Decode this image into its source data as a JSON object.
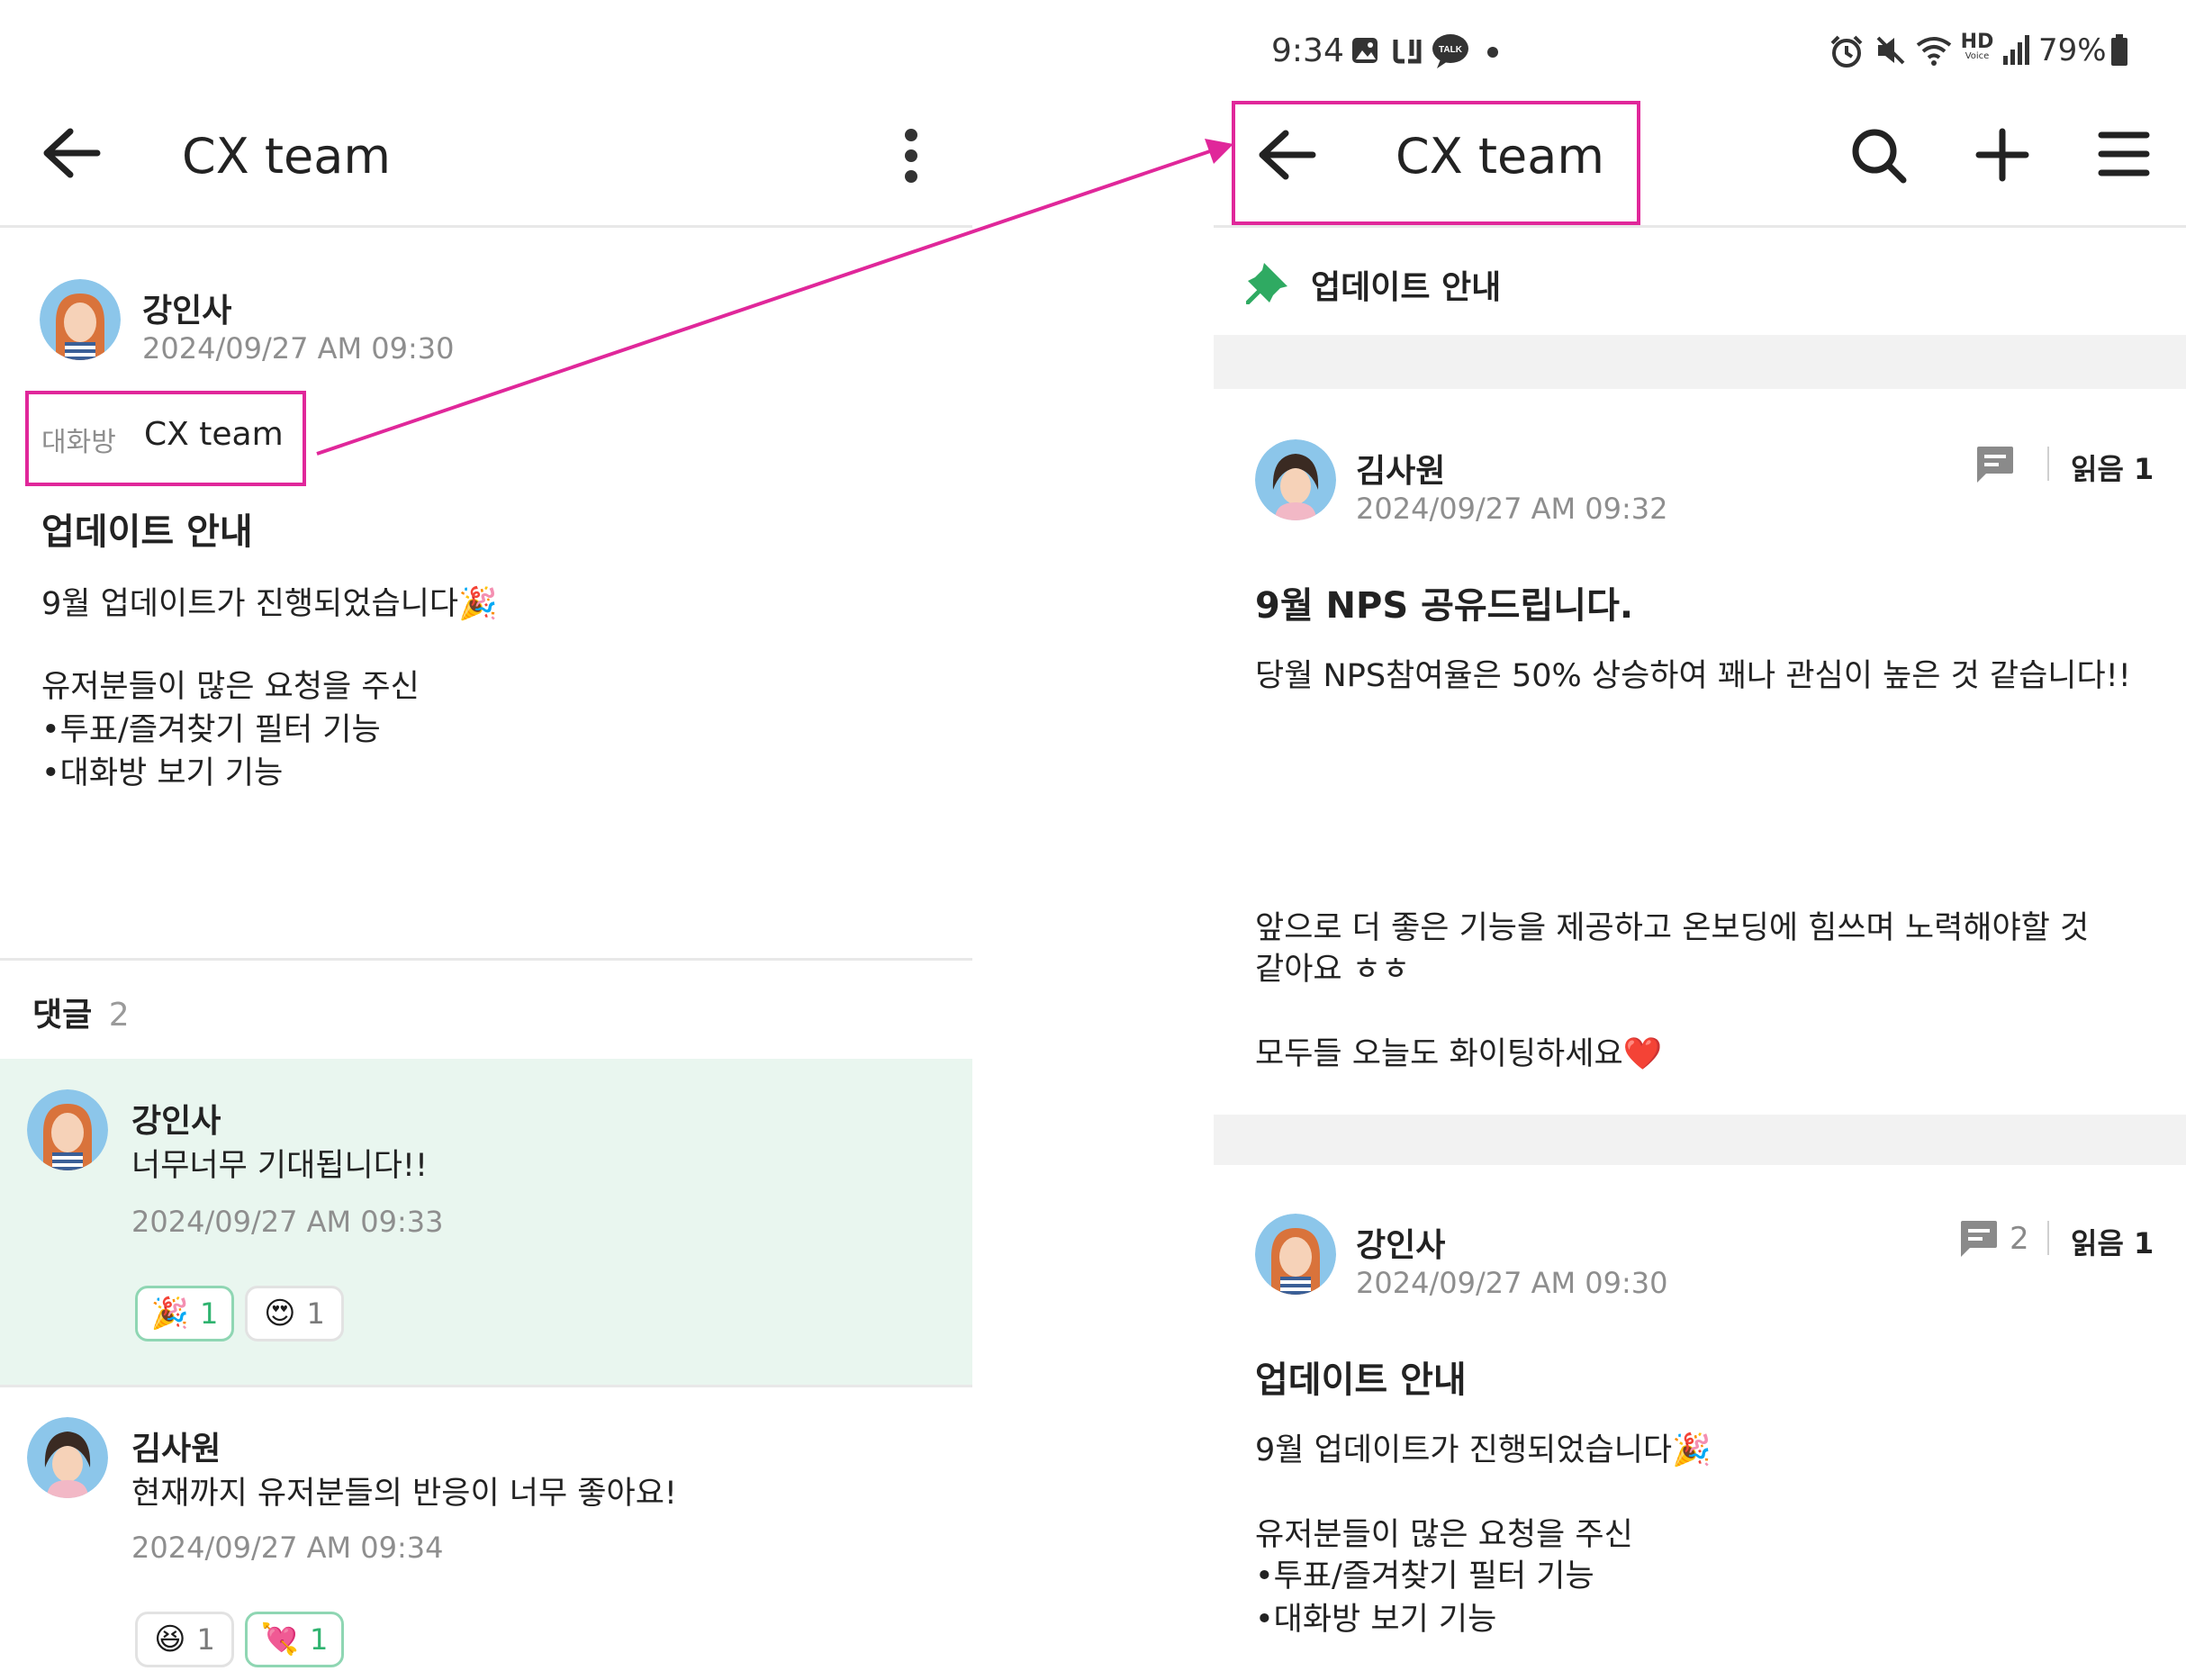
{
  "left": {
    "header": {
      "title": "CX team"
    },
    "post": {
      "author": "강인사",
      "date": "2024/09/27 AM 09:30",
      "room_label": "대화방",
      "room_name": "CX team",
      "title": "업데이트 안내",
      "lines": [
        "9월 업데이트가 진행되었습니다🎉",
        "",
        "유저분들이 많은 요청을 주신",
        "•투표/즐겨찾기 필터 기능",
        "•대화방 보기 기능"
      ]
    },
    "comments": {
      "label": "댓글",
      "count": "2",
      "items": [
        {
          "author": "강인사",
          "text": "너무너무 기대됩니다!!",
          "date": "2024/09/27 AM 09:33",
          "reactions": [
            {
              "emoji": "🎉",
              "count": "1",
              "mine": true
            },
            {
              "emoji": "😍",
              "count": "1",
              "mine": false
            }
          ]
        },
        {
          "author": "김사원",
          "text": "현재까지 유저분들의 반응이 너무 좋아요!",
          "date": "2024/09/27 AM 09:34",
          "reactions": [
            {
              "emoji": "😆",
              "count": "1",
              "mine": false
            },
            {
              "emoji": "💘",
              "count": "1",
              "mine": true
            }
          ]
        }
      ]
    }
  },
  "right": {
    "status_bar": {
      "time": "9:34",
      "battery": "79%",
      "hd_top": "HD",
      "hd_bottom": "Voice",
      "talk": "TALK"
    },
    "header": {
      "title": "CX team"
    },
    "notice": {
      "text": "업데이트 안내"
    },
    "posts": [
      {
        "author": "김사원",
        "date": "2024/09/27 AM 09:32",
        "comment_count": "",
        "read_label": "읽음 1",
        "title": "9월 NPS 공유드립니다.",
        "lines": [
          "당월 NPS참여율은 50% 상승하여 꽤나 관심이 높은 것 같습니다!!"
        ],
        "lines2": [
          "앞으로 더 좋은 기능을 제공하고 온보딩에 힘쓰며 노력해야할 것",
          "같아요 ㅎㅎ",
          "",
          "모두들 오늘도 화이팅하세요❤️"
        ]
      },
      {
        "author": "강인사",
        "date": "2024/09/27 AM 09:30",
        "comment_count": "2",
        "read_label": "읽음 1",
        "title": "업데이트 안내",
        "lines": [
          "9월 업데이트가 진행되었습니다🎉",
          "",
          "유저분들이 많은 요청을 주신",
          "•투표/즐겨찾기 필터 기능",
          "•대화방 보기 기능"
        ]
      }
    ]
  },
  "colors": {
    "highlight": "#e0279a",
    "comment_bg": "#e9f6ef",
    "muted": "#8e8e8e"
  }
}
